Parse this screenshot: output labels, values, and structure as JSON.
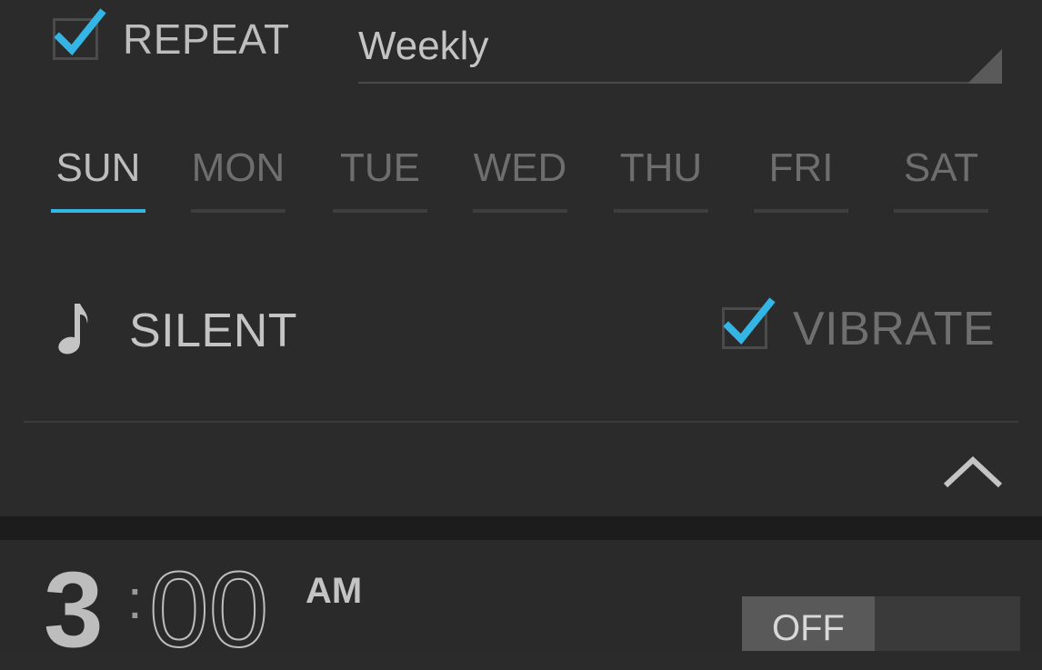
{
  "repeat": {
    "label": "REPEAT",
    "checked": true
  },
  "frequency": {
    "selected": "Weekly"
  },
  "days": [
    {
      "label": "SUN",
      "selected": true
    },
    {
      "label": "MON",
      "selected": false
    },
    {
      "label": "TUE",
      "selected": false
    },
    {
      "label": "WED",
      "selected": false
    },
    {
      "label": "THU",
      "selected": false
    },
    {
      "label": "FRI",
      "selected": false
    },
    {
      "label": "SAT",
      "selected": false
    }
  ],
  "ringtone": {
    "icon": "music-note-icon",
    "label": "SILENT"
  },
  "vibrate": {
    "label": "VIBRATE",
    "checked": true
  },
  "collapse": {
    "icon": "chevron-up-icon"
  },
  "next_alarm": {
    "hour": "3",
    "separator": ":",
    "minutes": "00",
    "ampm": "AM",
    "toggle_label": "OFF",
    "enabled": false
  },
  "colors": {
    "accent": "#33b5e5",
    "background": "#2b2b2b",
    "text": "#bdbdbd"
  }
}
